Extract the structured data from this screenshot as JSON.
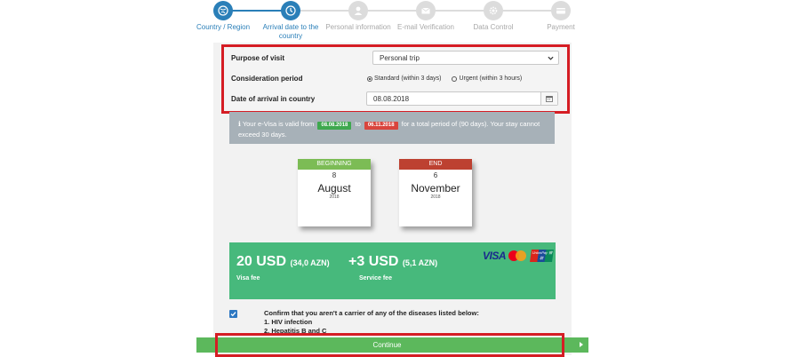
{
  "stepper": {
    "steps": [
      {
        "label": "Country / Region",
        "state": "active",
        "icon": "globe-icon"
      },
      {
        "label": "Arrival date to the country",
        "state": "active",
        "icon": "clock-icon"
      },
      {
        "label": "Personal information",
        "state": "inactive",
        "icon": "user-icon"
      },
      {
        "label": "E-mail Verification",
        "state": "inactive",
        "icon": "envelope-icon"
      },
      {
        "label": "Data Control",
        "state": "inactive",
        "icon": "gear-icon"
      },
      {
        "label": "Payment",
        "state": "inactive",
        "icon": "card-icon"
      }
    ],
    "active_color": "#2a7fb8",
    "inactive_color": "#dcdcdc"
  },
  "form": {
    "purpose_label": "Purpose of visit",
    "purpose_value": "Personal trip",
    "period_label": "Consideration period",
    "period_options": [
      {
        "label": "Standard (within 3 days)",
        "selected": true
      },
      {
        "label": "Urgent (within 3 hours)",
        "selected": false
      }
    ],
    "arrival_label": "Date of arrival in country",
    "arrival_value": "08.08.2018"
  },
  "info": {
    "prefix": "Your e-Visa is valid from",
    "start": "08.08.2018",
    "to": "to",
    "end": "06.11.2018",
    "suffix": "for a total period of (90 days). Your stay cannot exceed 30 days."
  },
  "calendar": {
    "begin": {
      "head": "BEGINNING",
      "day": "8",
      "month": "August",
      "year": "2018"
    },
    "end": {
      "head": "END",
      "day": "6",
      "month": "November",
      "year": "2018"
    }
  },
  "fees": {
    "visa_amount": "20 USD",
    "visa_sub": "(34,0 AZN)",
    "visa_label": "Visa fee",
    "service_amount": "+3 USD",
    "service_sub": "(5,1 AZN)",
    "service_label": "Service fee",
    "card_brands": {
      "visa": "VISA",
      "unionpay": "UnionPay 银联"
    },
    "box_color": "#47b97c"
  },
  "confirm": {
    "text": "Confirm that you aren't a carrier of any of the diseases listed below:",
    "items": [
      "1. HIV infection",
      "2. Hepatitis B and C"
    ],
    "checked": true
  },
  "continue_label": "Continue",
  "highlight_color": "#d51d24"
}
